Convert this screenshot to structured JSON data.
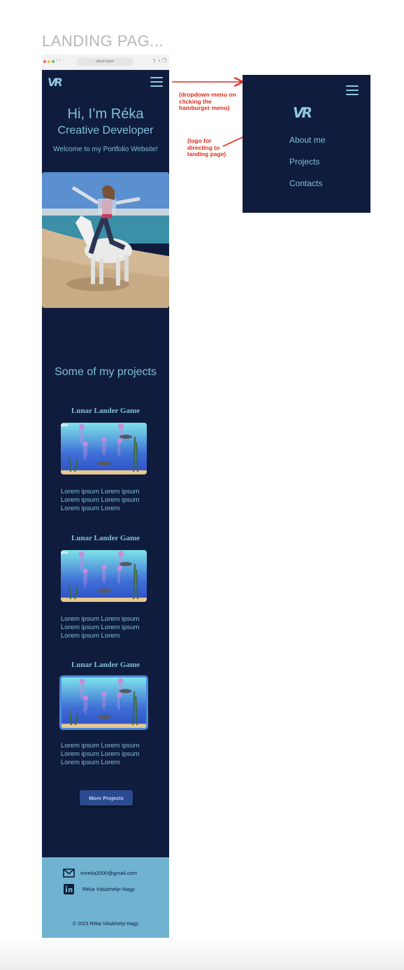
{
  "frame_title": "LANDING PAG...",
  "browser": {
    "url": "about:blank",
    "left_icons": "‹ › ▫",
    "right_icons": "⇧ + ❐"
  },
  "site": {
    "hero": {
      "title": "Hi, I’m Réka",
      "subtitle": "Creative Developer",
      "welcome": "Welcome to my Portfolio Website!"
    },
    "projects_title": "Some of my projects",
    "projects": [
      {
        "title": "Lunar Lander Game",
        "description": "Lorem ipsum Lorem ipsum Lorem ipsum Lorem ipsum Lorem ipsum Lorem"
      },
      {
        "title": "Lunar Lander Game",
        "description": "Lorem ipsum Lorem ipsum Lorem ipsum Lorem ipsum Lorem ipsum Lorem"
      },
      {
        "title": "Lunar Lander Game",
        "description": "Lorem ipsum Lorem ipsum Lorem ipsum Lorem ipsum Lorem ipsum Lorem"
      }
    ],
    "more_button": "More Projects",
    "footer": {
      "email": "vnreka2000@gmail.com",
      "linkedin": "Réka Vásárhelyi-Nagy",
      "copyright": "© 2023 Réka Vásárhelyi-Nagy"
    }
  },
  "dropdown": {
    "items": [
      "About me",
      "Projects",
      "Contacts"
    ]
  },
  "annotations": {
    "dropdown_note": "(dropdown menu on clicking the hamburger menu)",
    "logo_note": "(logo for directing to landing page)"
  },
  "colors": {
    "navy": "#0f1c3d",
    "accent": "#7fc0dc",
    "footer": "#6fb3d0",
    "button": "#2b4a8f",
    "annotation": "#e0291b"
  },
  "icons": [
    "logo-icon",
    "hamburger-icon",
    "mail-icon",
    "linkedin-icon"
  ]
}
